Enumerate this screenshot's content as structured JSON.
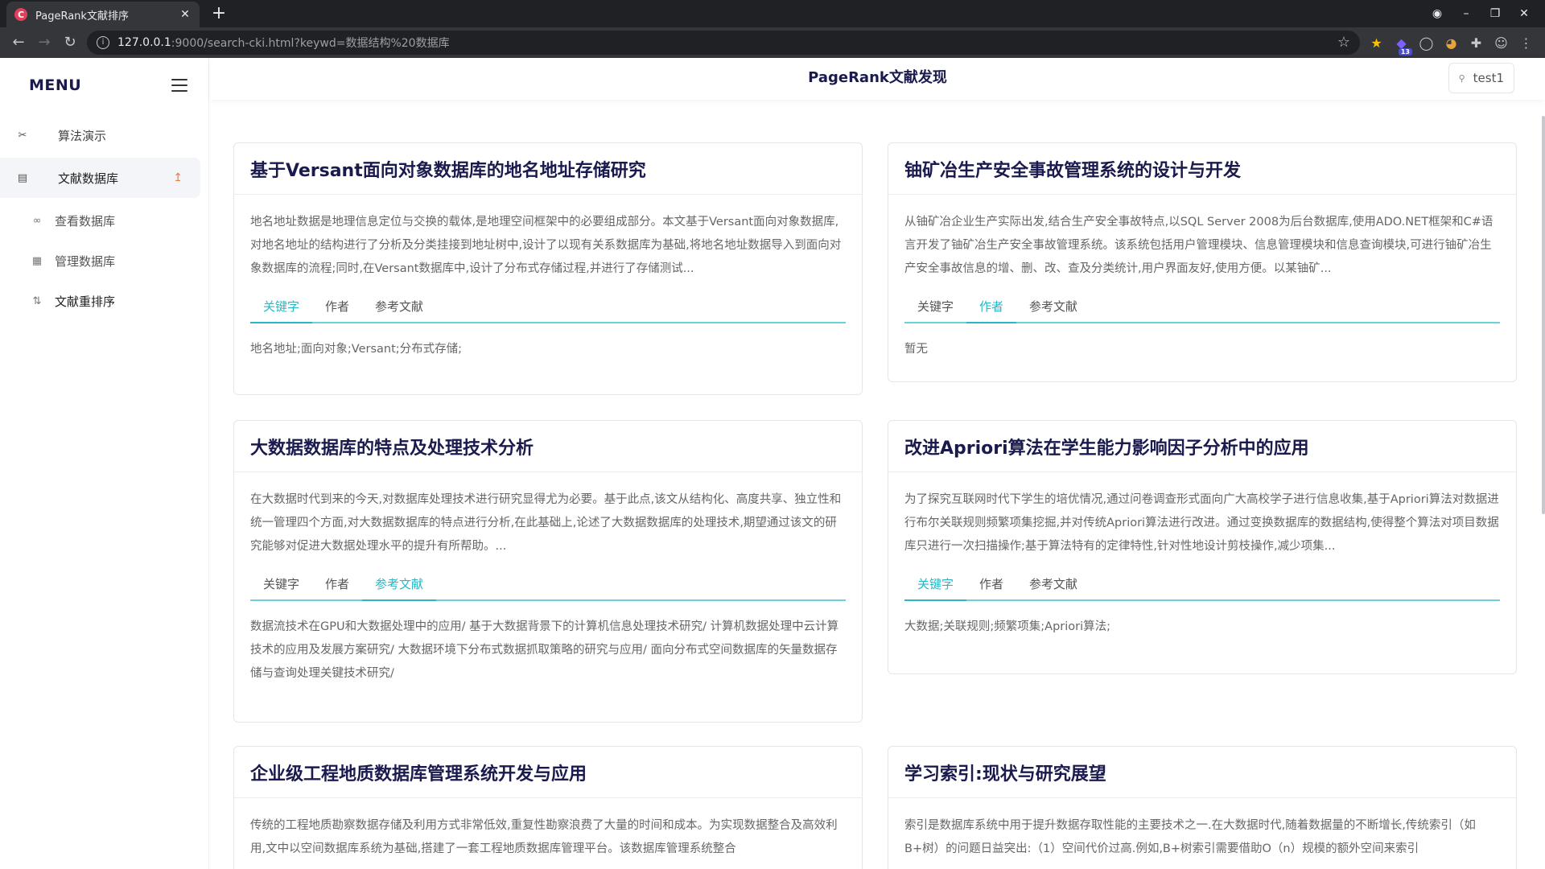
{
  "browser": {
    "tab_title": "PageRank文献排序",
    "favicon_letter": "C",
    "url_host": "127.0.0.1",
    "url_rest": ":9000/search-cki.html?keywd=数据结构%20数据库",
    "ext_badge": "13"
  },
  "sidebar": {
    "menu_title": "MENU",
    "items": [
      {
        "label": "算法演示",
        "icon": "wrench-icon"
      },
      {
        "label": "文献数据库",
        "icon": "database-icon"
      },
      {
        "label": "查看数据库",
        "icon": "glasses-icon"
      },
      {
        "label": "管理数据库",
        "icon": "calendar-icon"
      },
      {
        "label": "文献重排序",
        "icon": "sort-icon"
      }
    ]
  },
  "header": {
    "title": "PageRank文献发现",
    "user": "test1"
  },
  "tabs_labels": [
    "关键字",
    "作者",
    "参考文献"
  ],
  "cards": [
    {
      "title": "基于Versant面向对象数据库的地名地址存储研究",
      "abstract": "地名地址数据是地理信息定位与交换的载体,是地理空间框架中的必要组成部分。本文基于Versant面向对象数据库,对地名地址的结构进行了分析及分类挂接到地址树中,设计了以现有关系数据库为基础,将地名地址数据导入到面向对象数据库的流程;同时,在Versant数据库中,设计了分布式存储过程,并进行了存储测试...",
      "active_tab": 0,
      "tab_content": "地名地址;面向对象;Versant;分布式存储;"
    },
    {
      "title": "铀矿冶生产安全事故管理系统的设计与开发",
      "abstract": "从铀矿冶企业生产实际出发,结合生产安全事故特点,以SQL Server 2008为后台数据库,使用ADO.NET框架和C#语言开发了铀矿冶生产安全事故管理系统。该系统包括用户管理模块、信息管理模块和信息查询模块,可进行铀矿冶生产安全事故信息的增、删、改、查及分类统计,用户界面友好,使用方便。以某铀矿...",
      "active_tab": 1,
      "tab_content": "暂无"
    },
    {
      "title": "大数据数据库的特点及处理技术分析",
      "abstract": "在大数据时代到来的今天,对数据库处理技术进行研究显得尤为必要。基于此点,该文从结构化、高度共享、独立性和统一管理四个方面,对大数据数据库的特点进行分析,在此基础上,论述了大数据数据库的处理技术,期望通过该文的研究能够对促进大数据处理水平的提升有所帮助。...",
      "active_tab": 2,
      "tab_content": "数据流技术在GPU和大数据处理中的应用/ 基于大数据背景下的计算机信息处理技术研究/ 计算机数据处理中云计算技术的应用及发展方案研究/ 大数据环境下分布式数据抓取策略的研究与应用/ 面向分布式空间数据库的矢量数据存储与查询处理关键技术研究/"
    },
    {
      "title": "改进Apriori算法在学生能力影响因子分析中的应用",
      "abstract": "为了探究互联网时代下学生的培优情况,通过问卷调查形式面向广大高校学子进行信息收集,基于Apriori算法对数据进行布尔关联规则频繁项集挖掘,并对传统Apriori算法进行改进。通过变换数据库的数据结构,使得整个算法对项目数据库只进行一次扫描操作;基于算法特有的定律特性,针对性地设计剪枝操作,减少项集...",
      "active_tab": 0,
      "tab_content": "大数据;关联规则;频繁项集;Apriori算法;"
    },
    {
      "title": "企业级工程地质数据库管理系统开发与应用",
      "abstract": "传统的工程地质勘察数据存储及利用方式非常低效,重复性勘察浪费了大量的时间和成本。为实现数据整合及高效利用,文中以空间数据库系统为基础,搭建了一套工程地质数据库管理平台。该数据库管理系统整合",
      "active_tab": 0,
      "tab_content": ""
    },
    {
      "title": "学习索引:现状与研究展望",
      "abstract": "索引是数据库系统中用于提升数据存取性能的主要技术之一.在大数据时代,随着数据量的不断增长,传统索引（如B+树）的问题日益突出:（1）空间代价过高.例如,B+树索引需要借助O（n）规模的额外空间来索引",
      "active_tab": 0,
      "tab_content": ""
    }
  ]
}
